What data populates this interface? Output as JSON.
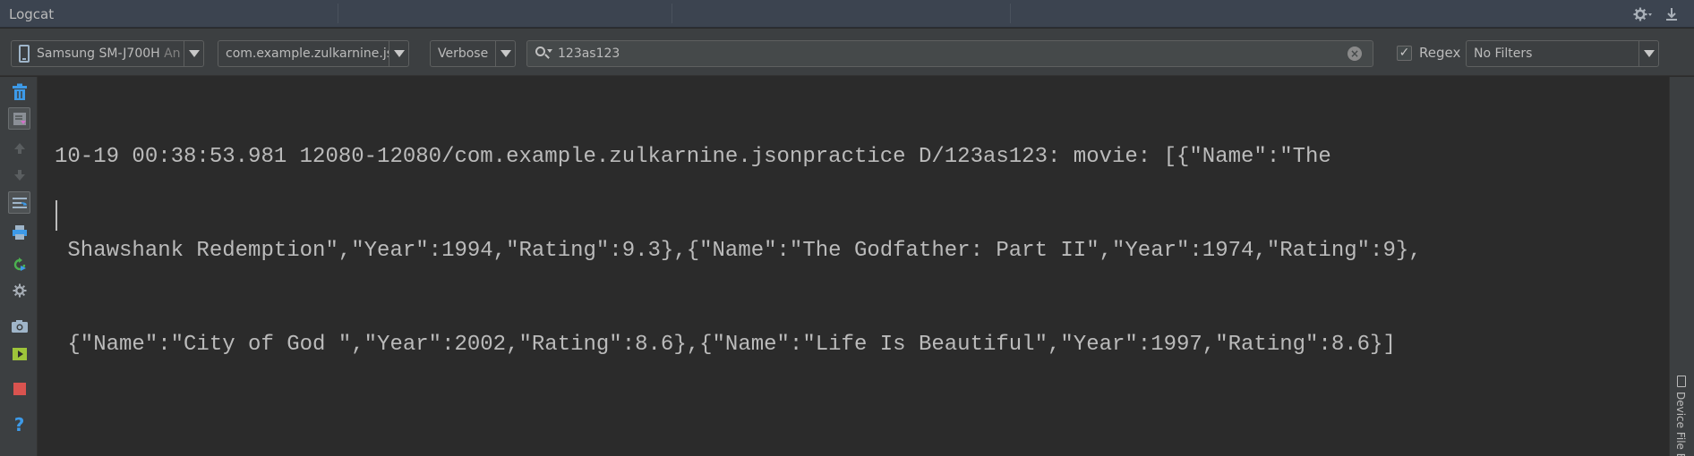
{
  "window": {
    "title": "Logcat"
  },
  "toolbar": {
    "device": {
      "name": "Samsung SM-J700H",
      "suffix": "An"
    },
    "process": {
      "name": "com.example.zulkarnine.jso"
    },
    "level": {
      "value": "Verbose"
    },
    "search": {
      "value": "123as123"
    },
    "regex": {
      "label": "Regex",
      "checked": true
    },
    "filter": {
      "value": "No Filters"
    }
  },
  "log": {
    "lines": [
      "10-19 00:38:53.981 12080-12080/com.example.zulkarnine.jsonpractice D/123as123: movie: [{\"Name\":\"The",
      " Shawshank Redemption\",\"Year\":1994,\"Rating\":9.3},{\"Name\":\"The Godfather: Part II\",\"Year\":1974,\"Rating\":9},",
      " {\"Name\":\"City of God \",\"Year\":2002,\"Rating\":8.6},{\"Name\":\"Life Is Beautiful\",\"Year\":1997,\"Rating\":8.6}]"
    ]
  },
  "right_panel": {
    "tab_label": "Device File E"
  },
  "icons": {
    "title": [
      "gear-icon",
      "minimize-icon"
    ],
    "sidebar": [
      "trash-icon",
      "scroll-to-end-icon",
      "up-arrow-icon",
      "down-arrow-icon",
      "soft-wraps-icon",
      "print-icon",
      "restart-icon",
      "settings-icon",
      "screenshot-icon",
      "screen-record-icon",
      "stop-icon",
      "help-icon"
    ]
  },
  "colors": {
    "accent_green": "#4cb050",
    "stop_red": "#d9534f",
    "help_blue": "#3d9ae8"
  }
}
